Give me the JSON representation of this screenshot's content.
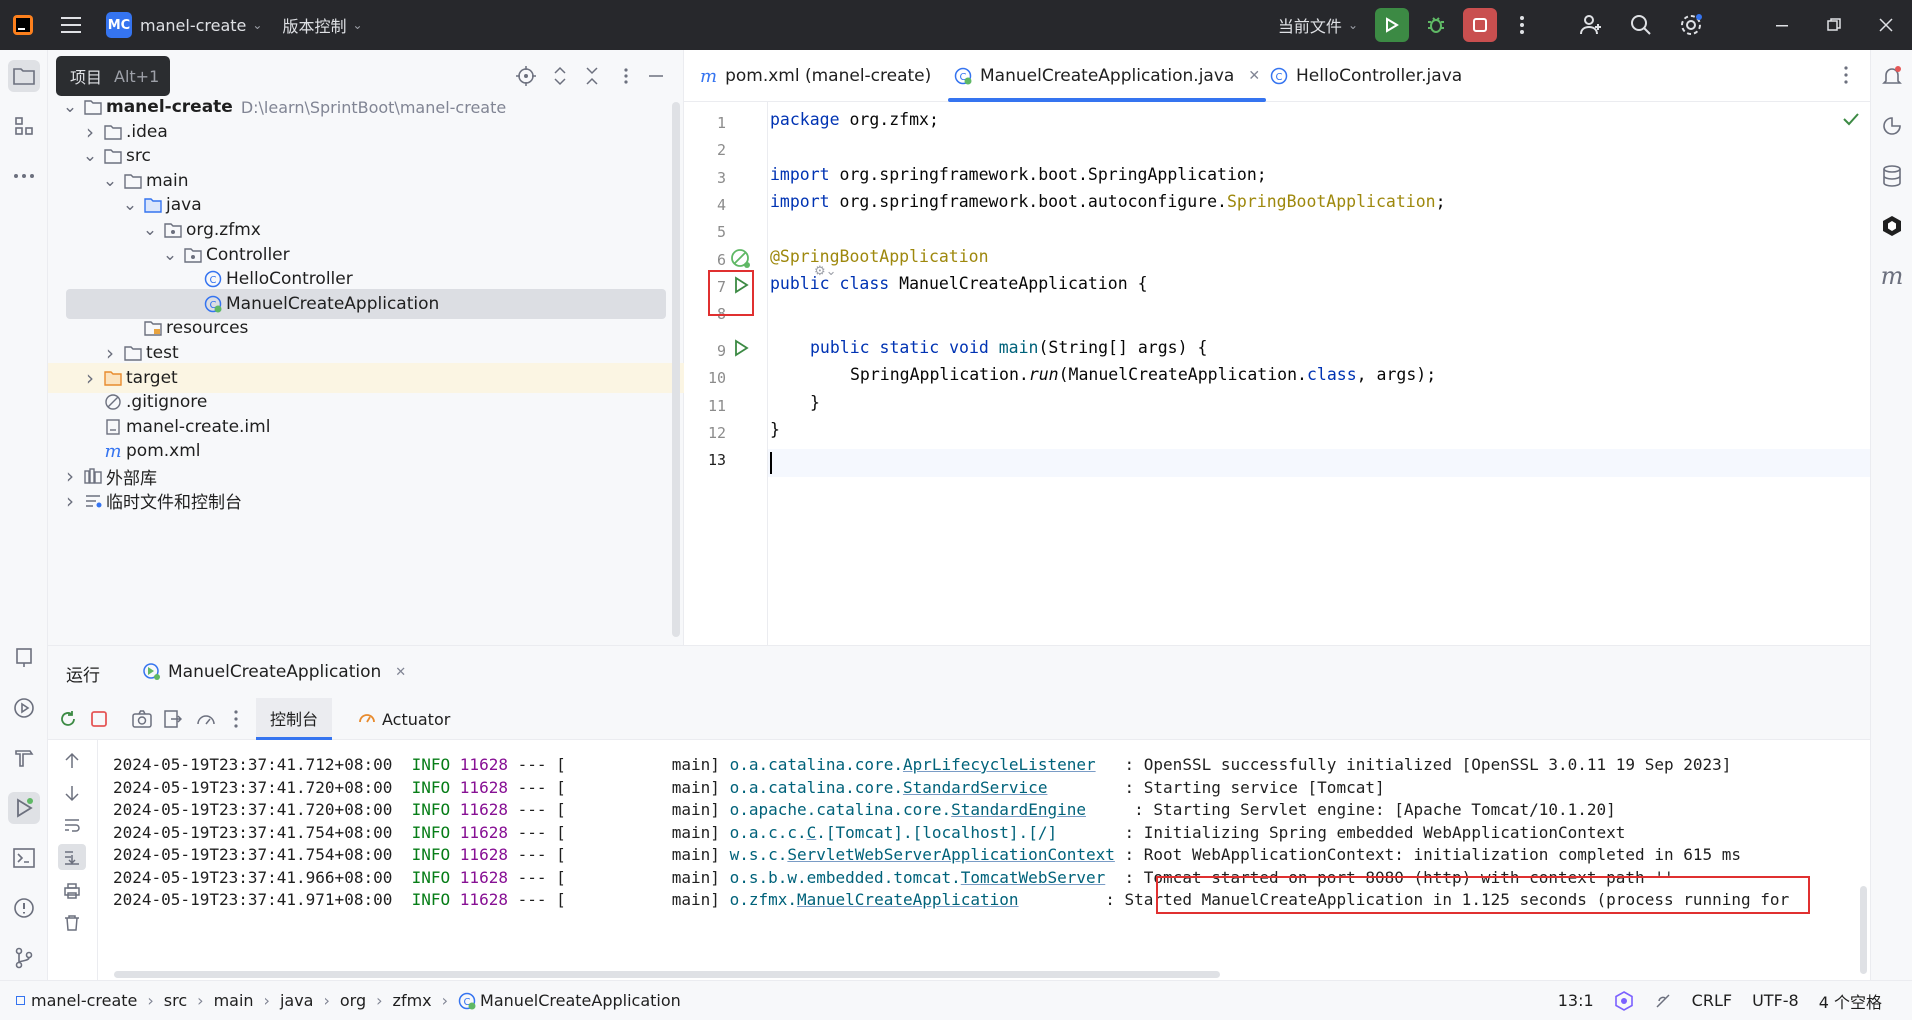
{
  "titlebar": {
    "project_badge": "MC",
    "project_name": "manel-create",
    "vcs_label": "版本控制",
    "run_config": "当前文件"
  },
  "tooltip": {
    "label": "项目",
    "shortcut": "Alt+1"
  },
  "project_tree": [
    {
      "label": "manel-create",
      "path": "D:\\learn\\SprintBoot\\manel-create",
      "depth": 0,
      "icon": "folder-icon",
      "expanded": true,
      "bold": true
    },
    {
      "label": ".idea",
      "depth": 1,
      "icon": "folder-icon",
      "expanded": false
    },
    {
      "label": "src",
      "depth": 1,
      "icon": "folder-icon",
      "expanded": true
    },
    {
      "label": "main",
      "depth": 2,
      "icon": "folder-icon",
      "expanded": true
    },
    {
      "label": "java",
      "depth": 3,
      "icon": "source-folder-icon",
      "expanded": true
    },
    {
      "label": "org.zfmx",
      "depth": 4,
      "icon": "package-icon",
      "expanded": true
    },
    {
      "label": "Controller",
      "depth": 5,
      "icon": "package-icon",
      "expanded": true
    },
    {
      "label": "HelloController",
      "depth": 6,
      "icon": "class-icon"
    },
    {
      "label": "ManuelCreateApplication",
      "depth": 6,
      "icon": "spring-class-icon",
      "selected": true
    },
    {
      "label": "resources",
      "depth": 3,
      "icon": "resources-folder-icon"
    },
    {
      "label": "test",
      "depth": 2,
      "icon": "folder-icon",
      "expanded": false
    },
    {
      "label": "target",
      "depth": 1,
      "icon": "excluded-folder-icon",
      "expanded": false,
      "highlight": true
    },
    {
      "label": ".gitignore",
      "depth": 1,
      "icon": "ignore-file-icon"
    },
    {
      "label": "manel-create.iml",
      "depth": 1,
      "icon": "module-file-icon"
    },
    {
      "label": "pom.xml",
      "depth": 1,
      "icon": "maven-icon"
    },
    {
      "label": "外部库",
      "depth": 0,
      "icon": "library-icon",
      "expanded": false
    },
    {
      "label": "临时文件和控制台",
      "depth": 0,
      "icon": "scratch-icon",
      "expanded": false
    }
  ],
  "editor_tabs": [
    {
      "label": "pom.xml (manel-create)",
      "icon": "maven-icon"
    },
    {
      "label": "ManuelCreateApplication.java",
      "icon": "spring-class-icon",
      "active": true
    },
    {
      "label": "HelloController.java",
      "icon": "class-icon"
    }
  ],
  "code_lines": [
    "1",
    "2",
    "3",
    "4",
    "5",
    "6",
    "7",
    "8",
    "9",
    "10",
    "11",
    "12",
    "13"
  ],
  "code": {
    "l1_kw": "package",
    "l1_rest": " org.zfmx;",
    "l3_kw": "import",
    "l3_rest": " org.springframework.boot.SpringApplication;",
    "l4_kw": "import",
    "l4_rest": " org.springframework.boot.autoconfigure.",
    "l4_ann": "SpringBootApplication",
    "l4_end": ";",
    "l6_ann": "@SpringBootApplication",
    "l7_kw": "public class",
    "l7_rest": " ManuelCreateApplication {",
    "l9_kw": "public static void",
    "l9_fn": "main",
    "l9_rest": "(String[] args) {",
    "l10_a": "SpringApplication.",
    "l10_run": "run",
    "l10_b": "(ManuelCreateApplication.",
    "l10_kw": "class",
    "l10_c": ", args);",
    "l11": "}",
    "l12": "}"
  },
  "run_panel": {
    "title": "运行",
    "config_tab": "ManuelCreateApplication",
    "console_tab": "控制台",
    "actuator_tab": "Actuator"
  },
  "log": [
    {
      "ts": "2024-05-19T23:37:41.712+08:00",
      "level": "INFO",
      "pid": "11628",
      "sep": "---",
      "thread": "[           main]",
      "pkg": "o.a.catalina.core.",
      "cls": "AprLifecycleListener",
      "pad": "   ",
      "msg": ": OpenSSL successfully initialized [OpenSSL 3.0.11 19 Sep 2023]"
    },
    {
      "ts": "2024-05-19T23:37:41.720+08:00",
      "level": "INFO",
      "pid": "11628",
      "sep": "---",
      "thread": "[           main]",
      "pkg": "o.a.catalina.core.",
      "cls": "StandardService",
      "pad": "        ",
      "msg": ": Starting service [Tomcat]"
    },
    {
      "ts": "2024-05-19T23:37:41.720+08:00",
      "level": "INFO",
      "pid": "11628",
      "sep": "---",
      "thread": "[           main]",
      "pkg": "o.apache.catalina.core.",
      "cls": "StandardEngine",
      "pad": "     ",
      "msg": ": Starting Servlet engine: [Apache Tomcat/10.1.20]"
    },
    {
      "ts": "2024-05-19T23:37:41.754+08:00",
      "level": "INFO",
      "pid": "11628",
      "sep": "---",
      "thread": "[           main]",
      "pkg": "o.a.c.c.",
      "cls": "C",
      "tail": ".[Tomcat].[localhost].[/]",
      "pad": "       ",
      "msg": ": Initializing Spring embedded WebApplicationContext"
    },
    {
      "ts": "2024-05-19T23:37:41.754+08:00",
      "level": "INFO",
      "pid": "11628",
      "sep": "---",
      "thread": "[           main]",
      "pkg": "w.s.c.",
      "cls": "ServletWebServerApplicationContext",
      "pad": " ",
      "msg": ": Root WebApplicationContext: initialization completed in 615 ms"
    },
    {
      "ts": "2024-05-19T23:37:41.966+08:00",
      "level": "INFO",
      "pid": "11628",
      "sep": "---",
      "thread": "[           main]",
      "pkg": "o.s.b.w.embedded.tomcat.",
      "cls": "TomcatWebServer",
      "pad": "  ",
      "msg": ": Tomcat started on port 8080 (http) with context path ''"
    },
    {
      "ts": "2024-05-19T23:37:41.971+08:00",
      "level": "INFO",
      "pid": "11628",
      "sep": "---",
      "thread": "[           main]",
      "pkg": "o.zfmx.",
      "cls": "ManuelCreateApplication",
      "pad": "         ",
      "msg": ": Started ManuelCreateApplication in 1.125 seconds (process running for"
    }
  ],
  "statusbar": {
    "crumbs": [
      "manel-create",
      "src",
      "main",
      "java",
      "org",
      "zfmx",
      "ManuelCreateApplication"
    ],
    "position": "13:1",
    "line_sep": "CRLF",
    "encoding": "UTF-8",
    "indent": "4 个空格"
  }
}
